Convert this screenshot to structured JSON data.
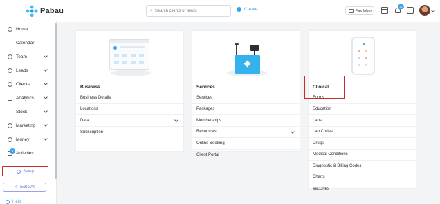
{
  "app": {
    "brand": "Pabau"
  },
  "topbar": {
    "search_placeholder": "Search clients or leads",
    "create_label": "Create",
    "fax_label": "Fax Inbox",
    "notification_count": "32"
  },
  "sidebar": {
    "items": [
      {
        "label": "Home",
        "icon": "home-icon",
        "expandable": false
      },
      {
        "label": "Calendar",
        "icon": "calendar-icon",
        "expandable": false
      },
      {
        "label": "Team",
        "icon": "team-icon",
        "expandable": true
      },
      {
        "label": "Leads",
        "icon": "leads-icon",
        "expandable": true
      },
      {
        "label": "Clients",
        "icon": "clients-icon",
        "expandable": true
      },
      {
        "label": "Analytics",
        "icon": "analytics-icon",
        "expandable": true
      },
      {
        "label": "Stock",
        "icon": "stock-icon",
        "expandable": true
      },
      {
        "label": "Marketing",
        "icon": "marketing-icon",
        "expandable": true
      },
      {
        "label": "Money",
        "icon": "money-icon",
        "expandable": true
      },
      {
        "label": "Activities",
        "icon": "activities-icon",
        "expandable": false,
        "badge": "0"
      }
    ],
    "setup_label": "Setup",
    "echo_label": "Echo AI",
    "help_label": "Help"
  },
  "cards": {
    "business": {
      "title": "Business",
      "items": [
        "Business Details",
        "Locations",
        "Data",
        "Subscription"
      ]
    },
    "services": {
      "title": "Services",
      "items": [
        "Services",
        "Packages",
        "Memberships",
        "Resources",
        "Online Booking",
        "Client Portal"
      ]
    },
    "clinical": {
      "title": "Clinical",
      "items": [
        "Forms",
        "Education",
        "Labs",
        "Lab Codes",
        "Drugs",
        "Medical Conditions",
        "Diagnostic & Billing Codes",
        "Charts",
        "Vaccines"
      ]
    }
  },
  "colors": {
    "accent": "#3aa0e8",
    "highlight": "#cc2a2a",
    "brand": "#38bdf2"
  }
}
